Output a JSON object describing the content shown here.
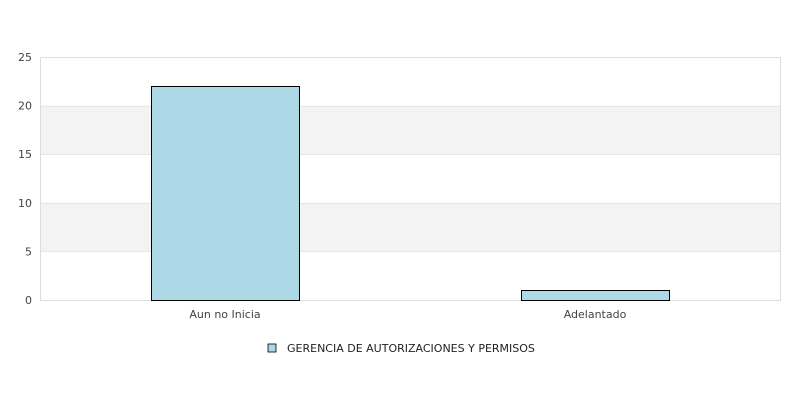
{
  "chart_data": {
    "type": "bar",
    "categories": [
      "Aun no Inicia",
      "Adelantado"
    ],
    "series": [
      {
        "name": "GERENCIA DE AUTORIZACIONES Y PERMISOS",
        "values": [
          22,
          1
        ]
      }
    ],
    "ylim": [
      0,
      25
    ],
    "yticks": [
      "0",
      "5",
      "10",
      "15",
      "20",
      "25"
    ],
    "grid": true,
    "banded_background": true,
    "legend_position": "bottom",
    "colors": {
      "bar_fill": "#add8e6",
      "bar_stroke": "#000000",
      "band_fill": "#f3f3f3",
      "plot_border": "#dddddd",
      "grid": "#e6e6e6"
    }
  }
}
